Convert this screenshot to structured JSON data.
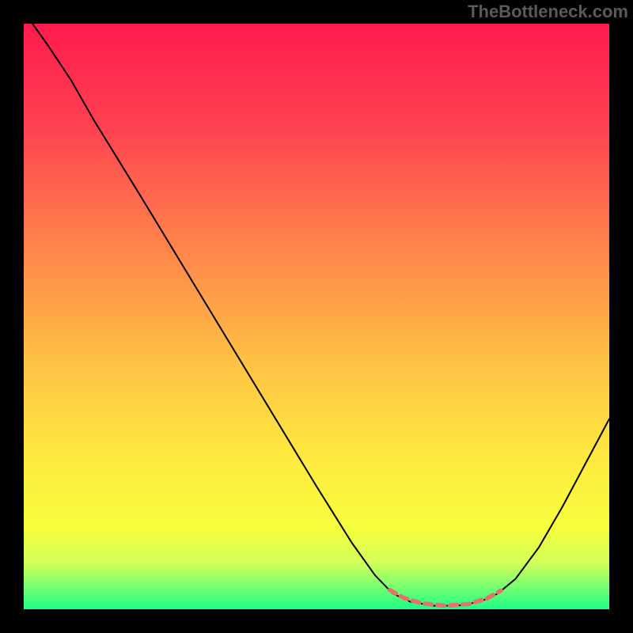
{
  "watermark": "TheBottleneck.com",
  "chart_data": {
    "type": "line",
    "title": "",
    "xlabel": "",
    "ylabel": "",
    "xlim": [
      0,
      100
    ],
    "ylim": [
      0,
      100
    ],
    "gradient_stops": [
      {
        "offset": 0,
        "color": "#ff1a4e"
      },
      {
        "offset": 18,
        "color": "#ff4350"
      },
      {
        "offset": 40,
        "color": "#ff8a4a"
      },
      {
        "offset": 58,
        "color": "#ffc244"
      },
      {
        "offset": 74,
        "color": "#ffe93f"
      },
      {
        "offset": 86,
        "color": "#f7ff3d"
      },
      {
        "offset": 92,
        "color": "#d3ff5a"
      },
      {
        "offset": 96,
        "color": "#7bff6e"
      },
      {
        "offset": 100,
        "color": "#1dff86"
      }
    ],
    "series": [
      {
        "name": "curve",
        "stroke": "#000000",
        "stroke_width": 2,
        "points": [
          {
            "x": 1.5,
            "y": 100.0
          },
          {
            "x": 4.0,
            "y": 96.5
          },
          {
            "x": 8.0,
            "y": 90.5
          },
          {
            "x": 12.0,
            "y": 83.5
          },
          {
            "x": 20.0,
            "y": 70.5
          },
          {
            "x": 30.0,
            "y": 54.0
          },
          {
            "x": 40.0,
            "y": 37.5
          },
          {
            "x": 50.0,
            "y": 21.0
          },
          {
            "x": 56.0,
            "y": 11.4
          },
          {
            "x": 60.0,
            "y": 5.8
          },
          {
            "x": 63.0,
            "y": 2.7
          },
          {
            "x": 66.0,
            "y": 1.3
          },
          {
            "x": 70.0,
            "y": 0.6
          },
          {
            "x": 74.0,
            "y": 0.6
          },
          {
            "x": 78.0,
            "y": 1.3
          },
          {
            "x": 81.0,
            "y": 2.7
          },
          {
            "x": 84.0,
            "y": 5.2
          },
          {
            "x": 88.0,
            "y": 10.6
          },
          {
            "x": 92.0,
            "y": 17.5
          },
          {
            "x": 96.0,
            "y": 25.0
          },
          {
            "x": 100.0,
            "y": 32.5
          }
        ]
      },
      {
        "name": "bottom-marks",
        "stroke": "#e6736b",
        "stroke_width": 5.5,
        "dash": [
          9,
          7
        ],
        "points": [
          {
            "x": 62.5,
            "y": 3.3
          },
          {
            "x": 65.0,
            "y": 1.9
          },
          {
            "x": 68.0,
            "y": 1.0
          },
          {
            "x": 72.0,
            "y": 0.6
          },
          {
            "x": 76.0,
            "y": 0.9
          },
          {
            "x": 79.0,
            "y": 1.8
          },
          {
            "x": 81.5,
            "y": 3.2
          }
        ]
      }
    ]
  }
}
